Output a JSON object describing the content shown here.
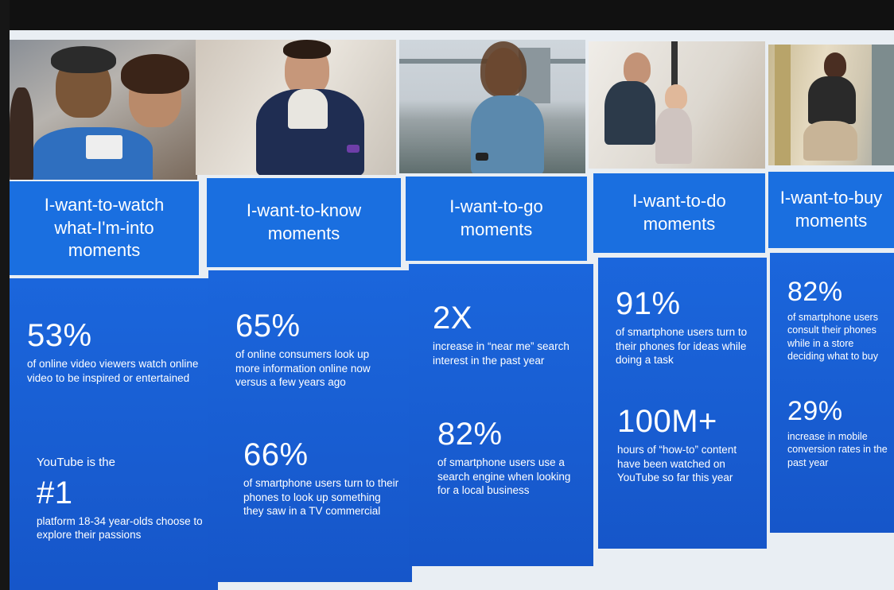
{
  "columns": [
    {
      "title_line1": "I-want-to-watch",
      "title_line2": "what-I'm-into",
      "title_line3": "moments",
      "stat1_value": "53%",
      "stat1_text": "of online video viewers watch online video to be inspired or entertained",
      "stat2_prefix": "YouTube is the",
      "stat2_value": "#1",
      "stat2_text": "platform 18-34 year-olds choose to explore their passions"
    },
    {
      "title_line1": "I-want-to-know",
      "title_line2": "moments",
      "stat1_value": "65%",
      "stat1_text": "of online consumers look up more information online now versus a few years ago",
      "stat2_value": "66%",
      "stat2_text": "of smartphone users turn to their phones to look up something they saw in a TV commercial"
    },
    {
      "title_line1": "I-want-to-go",
      "title_line2": "moments",
      "stat1_value": "2X",
      "stat1_text": "increase in “near me” search interest in  the past year",
      "stat2_value": "82%",
      "stat2_text": "of smartphone users use a search engine when looking for a local business"
    },
    {
      "title_line1": "I-want-to-do",
      "title_line2": "moments",
      "stat1_value": "91%",
      "stat1_text": "of smartphone users turn to their phones for ideas while doing a task",
      "stat2_value": "100M+",
      "stat2_text": "hours of “how-to” content have been watched on YouTube so far this year"
    },
    {
      "title_line1": "I-want-to-buy",
      "title_line2": "moments",
      "stat1_value": "82%",
      "stat1_text": "of smartphone users consult their phones while in a store deciding what to buy",
      "stat2_value": "29%",
      "stat2_text": "increase in mobile conversion rates in the past year"
    }
  ],
  "colors": {
    "panel_blue": "#1a6fe0",
    "stat_blue": "#1656c9",
    "divider": "#e9eef3"
  }
}
